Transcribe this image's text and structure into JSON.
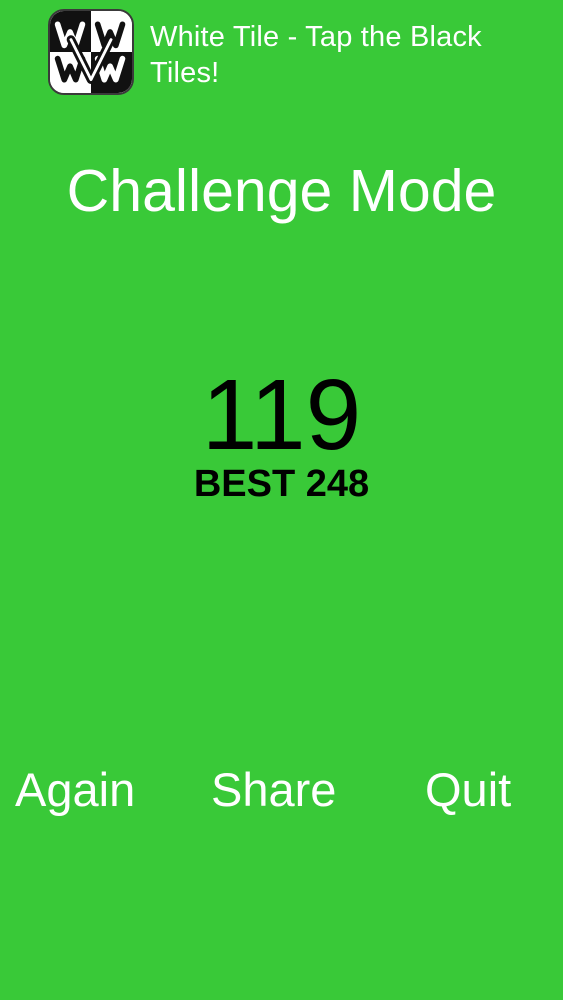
{
  "app": {
    "title": "White Tile - Tap the Black Tiles!",
    "icon": "white-tile-app-icon"
  },
  "result": {
    "mode_title": "Challenge Mode",
    "score": "119",
    "best_label": "BEST 248"
  },
  "actions": {
    "again_label": "Again",
    "share_label": "Share",
    "quit_label": "Quit"
  },
  "colors": {
    "background": "#39C938",
    "text_light": "#FFFFFF",
    "text_dark": "#000000"
  }
}
